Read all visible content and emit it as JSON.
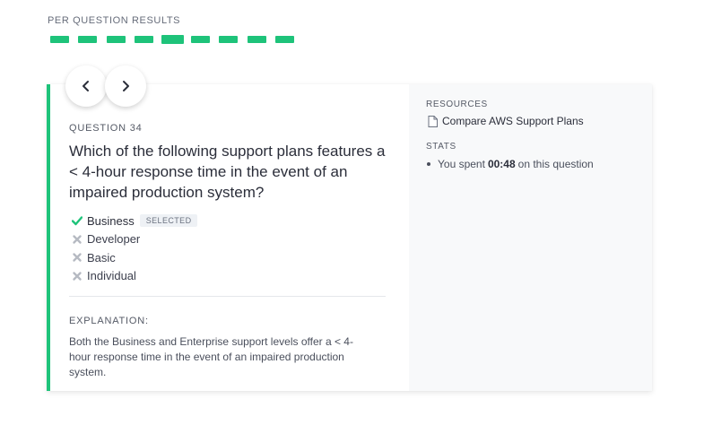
{
  "header": {
    "results_label": "PER QUESTION RESULTS"
  },
  "progress": {
    "segment_count": 9,
    "current_index": 4,
    "color": "#1ec37a"
  },
  "question": {
    "number_label": "QUESTION 34",
    "text": "Which of the following support plans features a < 4-hour response time in the event of an impaired production system?",
    "answers": [
      {
        "label": "Business",
        "status": "correct",
        "badge": "SELECTED"
      },
      {
        "label": "Developer",
        "status": "incorrect"
      },
      {
        "label": "Basic",
        "status": "incorrect"
      },
      {
        "label": "Individual",
        "status": "incorrect"
      }
    ]
  },
  "explanation": {
    "title": "EXPLANATION:",
    "text": "Both the Business and Enterprise support levels offer a < 4-hour response time in the event of an impaired production system."
  },
  "resources": {
    "title": "RESOURCES",
    "link_label": "Compare AWS Support Plans"
  },
  "stats": {
    "title": "STATS",
    "prefix": "You spent",
    "time": "00:48",
    "suffix": "on this question"
  },
  "colors": {
    "accent": "#1ec37a",
    "incorrect": "#b6bac2"
  }
}
